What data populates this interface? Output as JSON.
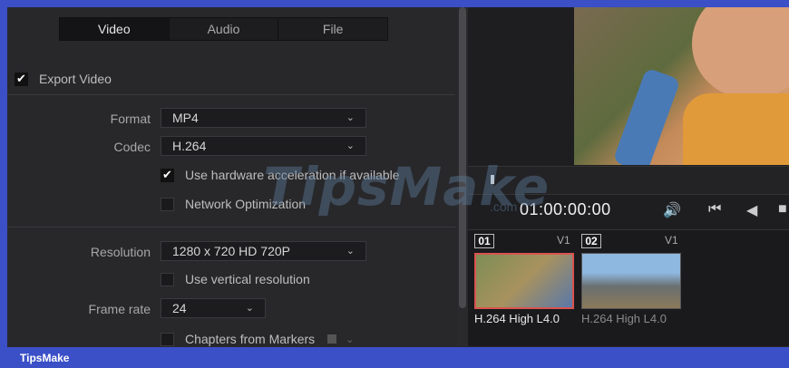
{
  "tabs": [
    "Video",
    "Audio",
    "File"
  ],
  "export_video": {
    "label": "Export Video",
    "checked": true
  },
  "format": {
    "label": "Format",
    "value": "MP4"
  },
  "codec": {
    "label": "Codec",
    "value": "H.264"
  },
  "hw_accel": {
    "label": "Use hardware acceleration if available",
    "checked": true
  },
  "network_opt": {
    "label": "Network Optimization",
    "checked": false
  },
  "resolution": {
    "label": "Resolution",
    "value": "1280 x 720 HD 720P"
  },
  "vertical_res": {
    "label": "Use vertical resolution",
    "checked": false
  },
  "frame_rate": {
    "label": "Frame rate",
    "value": "24"
  },
  "chapters": {
    "label": "Chapters from Markers",
    "checked": false
  },
  "viewer": {
    "timecode": "01:00:00:00"
  },
  "clips": [
    {
      "number": "01",
      "track": "V1",
      "codec": "H.264 High L4.0",
      "selected": true
    },
    {
      "number": "02",
      "track": "V1",
      "codec": "H.264 High L4.0",
      "selected": false
    }
  ],
  "watermark": {
    "text": "TipsMake",
    "suffix": ".com"
  },
  "footer": {
    "brand": "TipsMake"
  },
  "colors": {
    "accent_bar": "#3b4fc7",
    "selected_clip_border": "#d9534f"
  }
}
